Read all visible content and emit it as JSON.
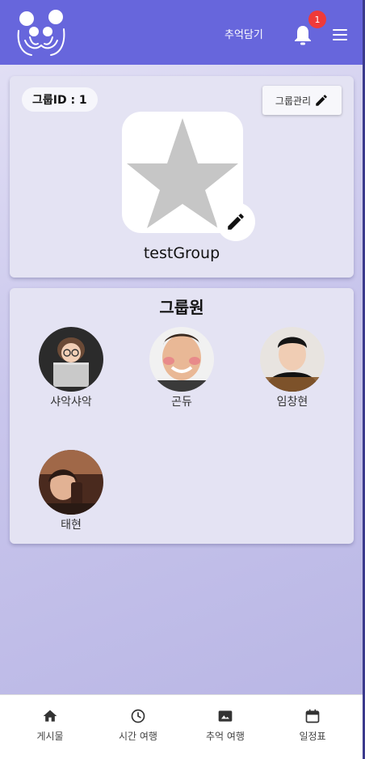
{
  "header": {
    "link_label": "추억담기",
    "notification_count": "1"
  },
  "group": {
    "id_label": "그룹ID : 1",
    "manage_label": "그룹관리",
    "name": "testGroup"
  },
  "members": {
    "title": "그룹원",
    "items": [
      {
        "name": "샤악샤악",
        "icon": "avatar-1"
      },
      {
        "name": "곤듀",
        "icon": "avatar-2"
      },
      {
        "name": "임창현",
        "icon": "avatar-3"
      },
      {
        "name": "태현",
        "icon": "avatar-4"
      }
    ]
  },
  "nav": {
    "items": [
      {
        "label": "게시물",
        "icon": "home-icon"
      },
      {
        "label": "시간 여행",
        "icon": "clock-icon"
      },
      {
        "label": "추억 여행",
        "icon": "photo-icon"
      },
      {
        "label": "일정표",
        "icon": "calendar-icon"
      }
    ]
  },
  "colors": {
    "header": "#6766dc",
    "badge": "#ef3a3a",
    "card": "#e4e3f3"
  }
}
